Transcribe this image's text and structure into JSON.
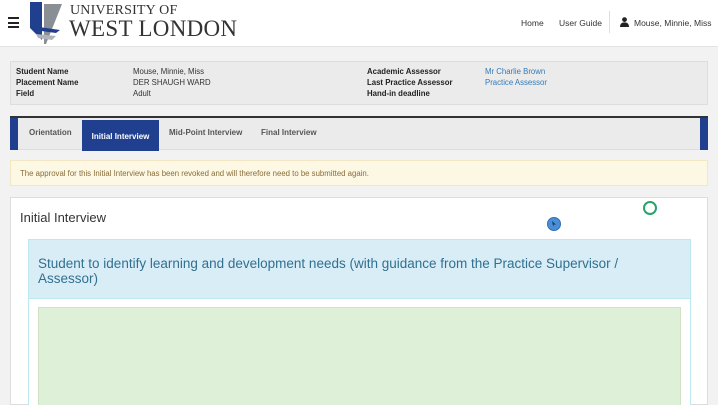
{
  "brand": {
    "line1": "UNIVERSITY OF",
    "line2": "WEST LONDON",
    "logo_icon": "uwl-shield-icon"
  },
  "nav": {
    "home": "Home",
    "user_guide": "User Guide",
    "user": "Mouse, Minnie, Miss",
    "user_icon": "user-icon",
    "menu_icon": "hamburger-icon"
  },
  "student_info": {
    "student_name_label": "Student Name",
    "student_name": "Mouse, Minnie, Miss",
    "placement_name_label": "Placement Name",
    "placement_name": "DER SHAUGH WARD",
    "field_label": "Field",
    "field": "Adult",
    "academic_assessor_label": "Academic Assessor",
    "academic_assessor": "Mr Charlie Brown",
    "last_practice_assessor_label": "Last Practice Assessor",
    "last_practice_assessor": "Practice Assessor",
    "hand_in_deadline_label": "Hand-in deadline"
  },
  "tabs": {
    "orientation": "Orientation",
    "initial_interview": "Initial Interview",
    "mid_point_interview": "Mid-Point Interview",
    "final_interview": "Final Interview",
    "active": "Initial Interview"
  },
  "alert": {
    "message": "The approval for this Initial Interview has been revoked and will therefore need to be submitted again."
  },
  "main": {
    "title": "Initial Interview",
    "section_heading": "Student to identify learning and development needs (with guidance from the Practice Supervisor / Assessor)"
  },
  "colors": {
    "primary": "#203f8f",
    "alert_bg": "#fcf8e3",
    "alert_text": "#8a6d3b",
    "info_bg": "#d9edf7",
    "info_text": "#31708f",
    "success_bg": "#dff0d8",
    "link": "#337ab7"
  }
}
